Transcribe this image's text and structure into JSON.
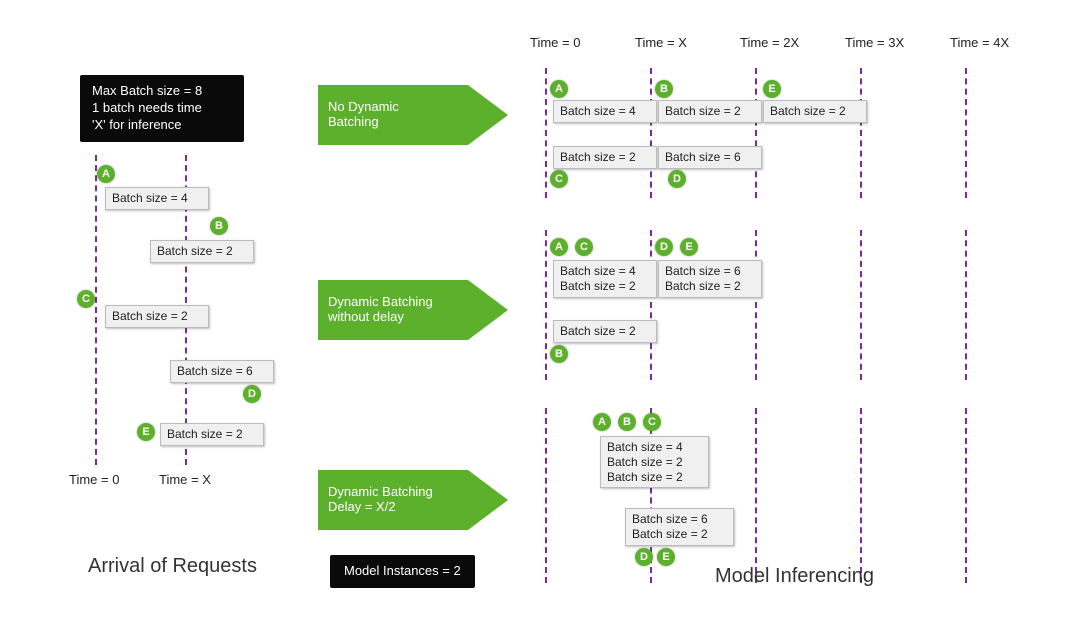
{
  "info_box": {
    "line1": "Max Batch size = 8",
    "line2": "1 batch needs time",
    "line3": "'X' for inference"
  },
  "left_timeline": {
    "t0": "Time = 0",
    "tX": "Time = X",
    "title": "Arrival of Requests",
    "requests": {
      "A": {
        "id": "A",
        "label": "Batch size = 4"
      },
      "B": {
        "id": "B",
        "label": "Batch size = 2"
      },
      "C": {
        "id": "C",
        "label": "Batch size = 2"
      },
      "D": {
        "id": "D",
        "label": "Batch size = 6"
      },
      "E": {
        "id": "E",
        "label": "Batch size = 2"
      }
    }
  },
  "arrows": {
    "a1": "No Dynamic\nBatching",
    "a2": "Dynamic Batching\nwithout delay",
    "a3": "Dynamic Batching\nDelay = X/2"
  },
  "right_timeline": {
    "ticks": {
      "t0": "Time = 0",
      "t1": "Time = X",
      "t2": "Time = 2X",
      "t3": "Time = 3X",
      "t4": "Time = 4X"
    },
    "title": "Model Inferencing"
  },
  "scenarios": {
    "no_dynamic": {
      "row1": {
        "s1": {
          "marker": "A",
          "label": "Batch size = 4"
        },
        "s2": {
          "marker": "B",
          "label": "Batch size = 2"
        },
        "s3": {
          "marker": "E",
          "label": "Batch size = 2"
        }
      },
      "row2": {
        "s1": {
          "marker": "C",
          "label": "Batch size = 2"
        },
        "s2": {
          "marker": "D",
          "label": "Batch size = 6"
        }
      }
    },
    "dyn_nodelay": {
      "row1": {
        "s1": {
          "markers": [
            "A",
            "C"
          ],
          "l1": "Batch size = 4",
          "l2": "Batch size = 2"
        },
        "s2": {
          "markers": [
            "D",
            "E"
          ],
          "l1": "Batch size = 6",
          "l2": "Batch size = 2"
        }
      },
      "row2": {
        "s1": {
          "marker": "B",
          "label": "Batch size = 2"
        }
      }
    },
    "dyn_delay": {
      "row1": {
        "markers": [
          "A",
          "B",
          "C"
        ],
        "l1": "Batch size = 4",
        "l2": "Batch size = 2",
        "l3": "Batch size = 2"
      },
      "row2": {
        "markers": [
          "D",
          "E"
        ],
        "l1": "Batch size = 6",
        "l2": "Batch size = 2"
      }
    }
  },
  "model_instances": "Model Instances = 2"
}
